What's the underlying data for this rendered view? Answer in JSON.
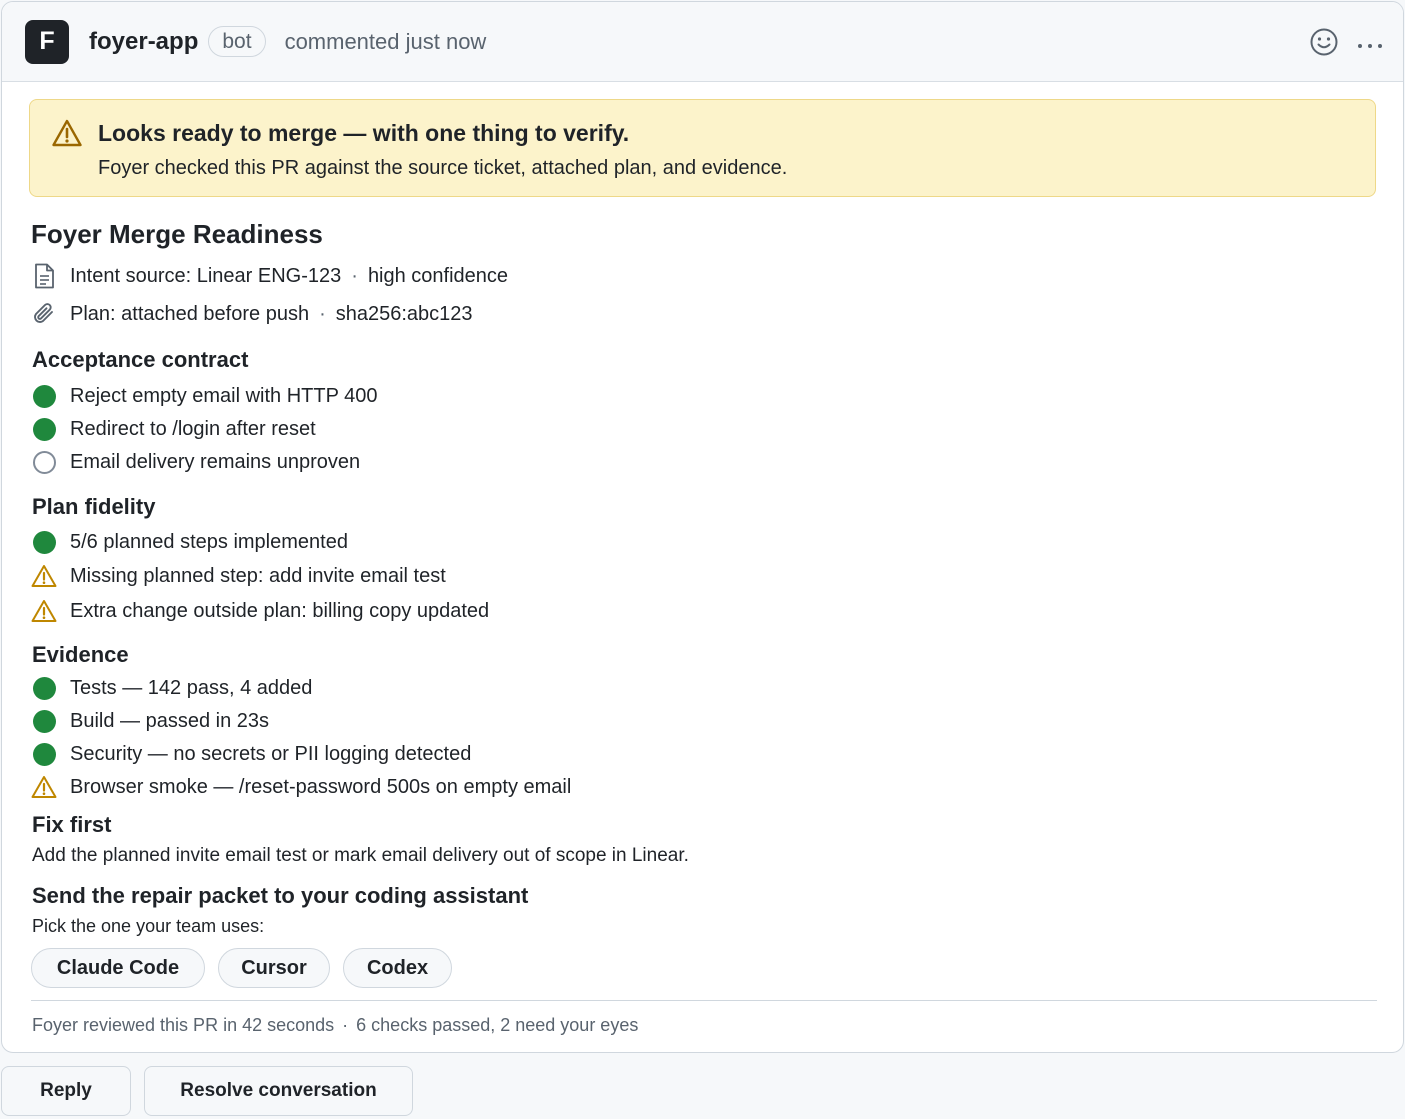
{
  "comment": {
    "avatar_letter": "F",
    "author": "foyer-app",
    "badge": "bot",
    "meta": "commented just now",
    "icons": {
      "reaction": "smiley-icon",
      "menu": "kebab-icon"
    }
  },
  "banner": {
    "title": "Looks ready to merge — with one thing to verify.",
    "subtitle": "Foyer checked this PR against the source ticket, attached plan, and evidence.",
    "icon": "warning-icon"
  },
  "readiness": {
    "title": "Foyer Merge Readiness",
    "intent": {
      "label": "Intent source: Linear ENG-123",
      "detail": "high confidence",
      "icon": "file-icon"
    },
    "plan": {
      "label": "Plan: attached before push",
      "detail": "sha256:abc123",
      "icon": "paperclip-icon"
    }
  },
  "acceptance": {
    "title": "Acceptance contract",
    "items": [
      {
        "text": "Reject empty email with HTTP 400",
        "status": "pass"
      },
      {
        "text": "Redirect to /login after reset",
        "status": "pass"
      },
      {
        "text": "Email delivery remains unproven",
        "status": "pending"
      }
    ]
  },
  "plan_fidelity": {
    "title": "Plan fidelity",
    "items": [
      {
        "text": "5/6 planned steps implemented",
        "status": "pass"
      },
      {
        "text": "Missing planned step: add invite email test",
        "status": "warn"
      },
      {
        "text": "Extra change outside plan: billing copy updated",
        "status": "warn"
      }
    ]
  },
  "evidence": {
    "title": "Evidence",
    "items": [
      {
        "text": "Tests — 142 pass, 4 added",
        "status": "pass"
      },
      {
        "text": "Build — passed in 23s",
        "status": "pass"
      },
      {
        "text": "Security — no secrets or PII logging detected",
        "status": "pass"
      },
      {
        "text": "Browser smoke — /reset-password 500s on empty email",
        "status": "warn"
      }
    ]
  },
  "fix_first": {
    "title": "Fix first",
    "text": "Add the planned invite email test or mark email delivery out of scope in Linear."
  },
  "repair": {
    "title": "Send the repair packet to your coding assistant",
    "subtitle": "Pick the one your team uses:",
    "options": [
      "Claude Code",
      "Cursor",
      "Codex"
    ]
  },
  "footer": {
    "review_time": "Foyer reviewed this PR in 42 seconds",
    "checks": "6 checks passed, 2 need your eyes"
  },
  "actions": {
    "reply": "Reply",
    "resolve": "Resolve conversation"
  },
  "colors": {
    "pass": "#1f883d",
    "warn": "#bf8700",
    "banner_bg": "#fcf3cb",
    "banner_border": "#eed888"
  }
}
